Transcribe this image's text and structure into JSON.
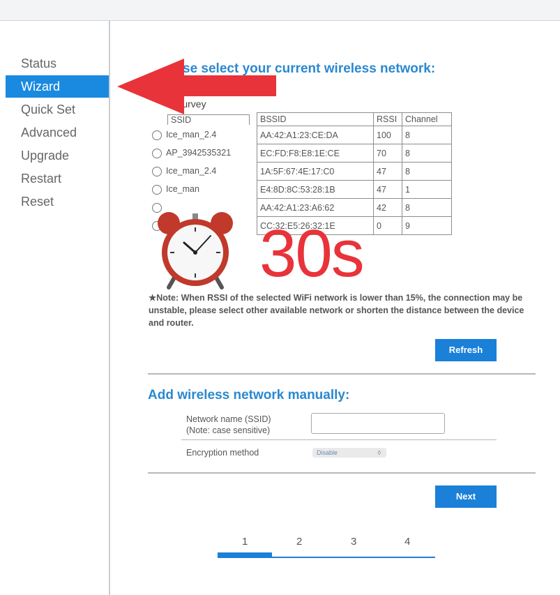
{
  "sidebar": {
    "items": [
      {
        "label": "Status",
        "active": false
      },
      {
        "label": "Wizard",
        "active": true
      },
      {
        "label": "Quick Set",
        "active": false
      },
      {
        "label": "Advanced",
        "active": false
      },
      {
        "label": "Upgrade",
        "active": false
      },
      {
        "label": "Restart",
        "active": false
      },
      {
        "label": "Reset",
        "active": false
      }
    ]
  },
  "main": {
    "heading_fragment": "se select your current wireless network:",
    "survey_label": "Survey",
    "table": {
      "headers": [
        "SSID",
        "BSSID",
        "RSSI",
        "Channel"
      ],
      "rows": [
        [
          "Ice_man_2.4",
          "AA:42:A1:23:CE:DA",
          "100",
          "8"
        ],
        [
          "AP_3942535321",
          "EC:FD:F8:E8:1E:CE",
          "70",
          "8"
        ],
        [
          "Ice_man_2.4",
          "1A:5F:67:4E:17:C0",
          "47",
          "8"
        ],
        [
          "Ice_man",
          "E4:8D:8C:53:28:1B",
          "47",
          "1"
        ],
        [
          "",
          "AA:42:A1:23:A6:62",
          "42",
          "8"
        ],
        [
          "",
          "CC:32:E5:26:32:1E",
          "0",
          "9"
        ]
      ]
    },
    "overlay_timer": "30s",
    "note": "★Note: When RSSI of the selected WiFi network is lower than 15%, the connection may be unstable, please select other available network or shorten the distance between the device and router.",
    "refresh_label": "Refresh",
    "manual_heading": "Add wireless network manually:",
    "ssid_label_line1": "Network name (SSID)",
    "ssid_label_line2": "(Note: case sensitive)",
    "ssid_value": "",
    "encryption_label": "Encryption method",
    "encryption_value": "Disable",
    "next_label": "Next",
    "steps": [
      "1",
      "2",
      "3",
      "4"
    ],
    "current_step": 1
  },
  "colors": {
    "accent": "#1a80d8",
    "nav_active": "#1a8ae0",
    "heading": "#2a88d0",
    "arrow": "#e8333a",
    "timer": "#e8333a"
  },
  "icons": [
    "red-arrow-annotation",
    "alarm-clock-icon"
  ]
}
